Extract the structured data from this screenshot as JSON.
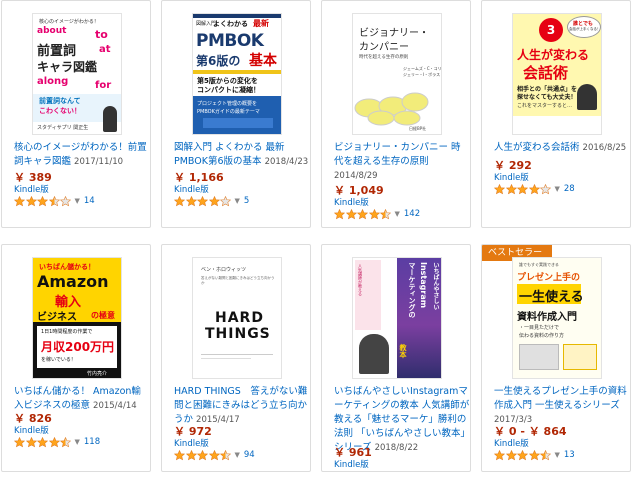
{
  "products": [
    {
      "title": "核心のイメージがわかる！前置詞キャラ図鑑",
      "date": "2017/11/10",
      "price": "￥ 389",
      "format": "Kindle版",
      "rating": 3.5,
      "reviews": "14",
      "cover": {
        "line1": "核心のイメージがわかる！",
        "line2": "前置詞",
        "line3": "キャラ図鑑",
        "w1": "about",
        "w2": "to",
        "w3": "at",
        "w4": "along",
        "w5": "for",
        "band": "前置詞なんて",
        "band2": "こわくない！",
        "author": "スタディサプリ 関正生"
      }
    },
    {
      "title": "図解入門 よくわかる 最新PMBOK第6版の基本",
      "date": "2018/4/23",
      "price": "￥ 1,166",
      "format": "Kindle版",
      "rating": 4.0,
      "reviews": "5",
      "cover": {
        "top1": "図解入門",
        "top2": "よくわかる",
        "top3": "最新",
        "big1": "PMBOK",
        "big2": "第6版の",
        "big3": "基本",
        "band1": "第5版からの変化を",
        "band2": "コンパクトに凝縮！",
        "blue1": "プロジェクト管理の概要を",
        "blue2": "PMBOKガイドの最新テーマ"
      }
    },
    {
      "title": "ビジョナリー・カンパニー 時代を超える生存の原則",
      "date": "2014/8/29",
      "price": "￥ 1,049",
      "format": "Kindle版",
      "rating": 4.5,
      "reviews": "142",
      "cover": {
        "t1": "ビジョナリー・",
        "t2": "カンパニー",
        "sub": "時代を超える生存の原則",
        "auth1": "ジェームズ・C・コリンズ",
        "auth2": "ジェリー・I・ポラス",
        "pub": "日経BP社"
      }
    },
    {
      "title": "人生が変わる会話術",
      "date": "2016/8/25",
      "price": "￥ 292",
      "format": "Kindle版",
      "rating": 4.0,
      "reviews": "28",
      "cover": {
        "bubble1": "誰とでも",
        "bubble2": "会話が上手くなる！",
        "num": "3",
        "t1": "人生が変わる",
        "t2": "会話術",
        "band1": "相手との「共通点」を",
        "band2": "探せなくても大丈夫！",
        "foot": "これをマスターすると…"
      }
    },
    {
      "title": "いちばん儲かる！ Amazon輸入ビジネスの極意",
      "date": "2015/4/14",
      "price": "￥ 826",
      "format": "Kindle版",
      "rating": 4.5,
      "reviews": "118",
      "cover": {
        "t0": "いちばん儲かる！",
        "t1": "Amazon",
        "t2": "輸入",
        "t3": "ビジネス",
        "t4": "の極意",
        "box1": "1日1時間程度の作業で",
        "box2": "月収200万円",
        "box3": "を稼いでいる！",
        "author": "竹内亮介"
      }
    },
    {
      "title": "HARD THINGS　答えがない難問と困難にきみはどう立ち向かうか",
      "date": "2015/4/17",
      "price": "￥ 972",
      "format": "Kindle版",
      "rating": 4.5,
      "reviews": "94",
      "cover": {
        "t1": "HARD",
        "t2": "THINGS",
        "author": "ベン・ホロウィッツ",
        "sub": "答えがない難問と困難にきみはどう立ち向かうか"
      }
    },
    {
      "title": "いちばんやさしいInstagramマーケティングの教本 人気講師が教える「魅せるマーケ」勝利の法則 「いちばんやさしい教本」シリーズ",
      "date": "2018/8/22",
      "price": "￥ 961",
      "format": "Kindle版",
      "rating": 5.0,
      "reviews": "8",
      "cover": {
        "v1": "いちばんやさしい",
        "v2": "Instagram",
        "v3": "マーケティングの",
        "v4": "教本",
        "side": "人気講師が教える"
      }
    },
    {
      "title": "一生使えるプレゼン上手の資料作成入門 一生使えるシリーズ",
      "date": "2017/3/3",
      "price": "￥ 0 - ￥ 864",
      "format": "Kindle版",
      "rating": 4.5,
      "reviews": "13",
      "badge": "ベストセラー",
      "cover": {
        "top": "誰でもすぐ実践できる",
        "t1": "プレゼン上手の",
        "t2": "一生使える",
        "t3": "資料作成入門",
        "note1": "・一目見ただけで",
        "note2": "伝わる資料の作り方"
      }
    }
  ],
  "colors": {
    "link": "#0066c0",
    "price": "#b12704",
    "star": "#ffa41c",
    "badge": "#e47911"
  }
}
